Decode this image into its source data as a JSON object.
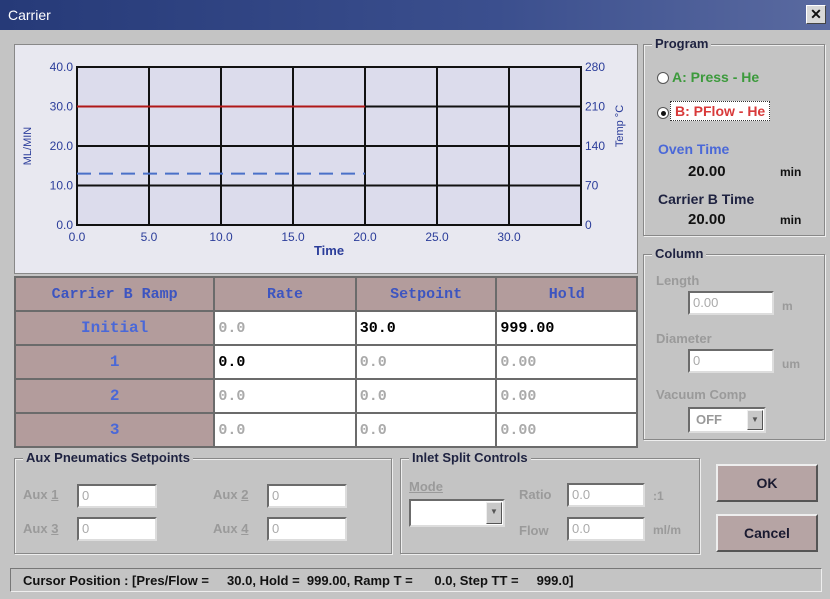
{
  "window": {
    "title": "Carrier",
    "close_glyph": "✕"
  },
  "chart_data": {
    "type": "line",
    "xlabel": "Time",
    "ylabel": "ML/MIN",
    "y2label": "Temp °C",
    "x_ticks": [
      "0.0",
      "5.0",
      "10.0",
      "15.0",
      "20.0",
      "25.0",
      "30.0"
    ],
    "y_ticks": [
      "0.0",
      "10.0",
      "20.0",
      "30.0",
      "40.0"
    ],
    "y2_ticks": [
      "0",
      "70",
      "140",
      "210",
      "280"
    ],
    "xlim": [
      0,
      35
    ],
    "ylim": [
      0,
      40
    ],
    "y2lim": [
      0,
      280
    ],
    "series": [
      {
        "color": "#b01818",
        "style": "solid",
        "x": [
          0,
          20
        ],
        "y": [
          30,
          30
        ]
      },
      {
        "color": "#4a70c8",
        "style": "dashed",
        "x": [
          0,
          20
        ],
        "y": [
          13,
          13
        ]
      }
    ],
    "grid": true,
    "grid_color": "#111111",
    "plot_background": "#dcdcec"
  },
  "ramp_table": {
    "headers": [
      "Carrier B Ramp",
      "Rate",
      "Setpoint",
      "Hold"
    ],
    "rows": [
      {
        "label": "Initial",
        "rate": "0.0",
        "setpoint": "30.0",
        "hold": "999.00"
      },
      {
        "label": "1",
        "rate": "0.0",
        "setpoint": "0.0",
        "hold": "0.00"
      },
      {
        "label": "2",
        "rate": "0.0",
        "setpoint": "0.0",
        "hold": "0.00"
      },
      {
        "label": "3",
        "rate": "0.0",
        "setpoint": "0.0",
        "hold": "0.00"
      }
    ]
  },
  "program": {
    "title": "Program",
    "option_a": "A: Press - He",
    "option_b": "B: PFlow - He",
    "selected": "B",
    "color_a": "#3c9a3c",
    "color_b": "#d83a3a",
    "oven_time_label": "Oven Time",
    "oven_time_value": "20.00",
    "oven_time_unit": "min",
    "carrier_b_time_label": "Carrier B Time",
    "carrier_b_time_value": "20.00",
    "carrier_b_time_unit": "min"
  },
  "column": {
    "title": "Column",
    "length_label": "Length",
    "length_value": "0.00",
    "length_unit": "m",
    "diameter_label": "Diameter",
    "diameter_value": "0",
    "diameter_unit": "um",
    "vacuum_comp_label": "Vacuum Comp",
    "vacuum_comp_value": "OFF"
  },
  "aux": {
    "title": "Aux Pneumatics Setpoints",
    "aux1_label": "Aux",
    "aux1_num": "1",
    "aux1_value": "0",
    "aux2_label": "Aux",
    "aux2_num": "2",
    "aux2_value": "0",
    "aux3_label": "Aux",
    "aux3_num": "3",
    "aux3_value": "0",
    "aux4_label": "Aux",
    "aux4_num": "4",
    "aux4_value": "0"
  },
  "inlet_split": {
    "title": "Inlet Split Controls",
    "mode_label": "Mode",
    "mode_value": "",
    "ratio_label": "Ratio",
    "ratio_value": "0.0",
    "ratio_unit": ":1",
    "flow_label": "Flow",
    "flow_value": "0.0",
    "flow_unit": "ml/m"
  },
  "buttons": {
    "ok": "OK",
    "cancel": "Cancel"
  },
  "status": {
    "text": "Cursor Position : [Pres/Flow =     30.0, Hold =  999.00, Ramp T =      0.0, Step TT =     999.0]"
  }
}
